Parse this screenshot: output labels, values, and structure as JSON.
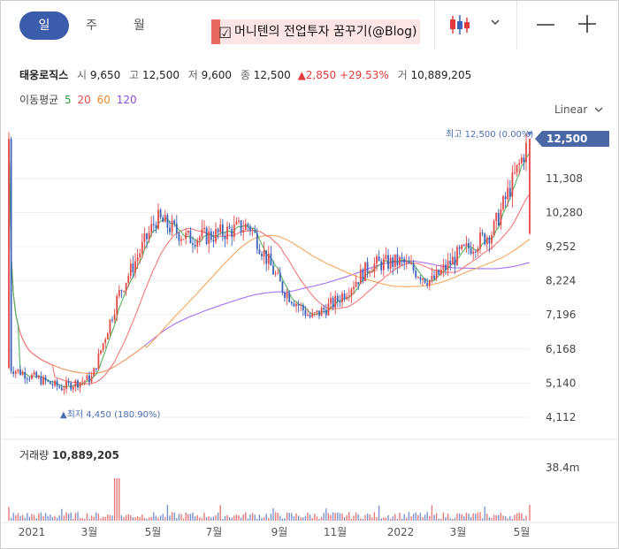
{
  "tabs": {
    "day": "일",
    "week": "주",
    "month": "월"
  },
  "watermark": "머니텐의 전업투자 꿈꾸기(@Blog)",
  "stock": {
    "name": "태웅로직스",
    "open_label": "시",
    "open": "9,650",
    "high_label": "고",
    "high": "12,500",
    "low_label": "저",
    "low": "9,600",
    "close_label": "종",
    "close": "12,500",
    "change": "▲2,850",
    "change_pct": "+29.53%",
    "volume_label": "거",
    "volume": "10,889,205"
  },
  "ma": {
    "label": "이동평균",
    "p5": "5",
    "p20": "20",
    "p60": "60",
    "p120": "120"
  },
  "scale_label": "Linear",
  "chart_data": {
    "type": "candlestick",
    "ticker_name": "태웅로직스",
    "y_ticks": [
      "12,500",
      "11,308",
      "10,280",
      "9,252",
      "8,224",
      "7,196",
      "6,168",
      "5,140",
      "4,112"
    ],
    "y_tick_values": [
      12500,
      11308,
      10280,
      9252,
      8224,
      7196,
      6168,
      5140,
      4112
    ],
    "x_ticks": [
      "2021",
      "3월",
      "5월",
      "7월",
      "9월",
      "11월",
      "2022",
      "3월",
      "5월"
    ],
    "high_annotation": "최고 12,500 (0.00%)",
    "low_annotation": "▲최저 4,450 (180.90%)",
    "last_price_label": "12,500",
    "price_series_approx": [
      {
        "date": "2021-01",
        "close": 5600
      },
      {
        "date": "2021-02",
        "close": 5000
      },
      {
        "date": "2021-03",
        "close": 5300
      },
      {
        "date": "2021-04",
        "close": 7800
      },
      {
        "date": "2021-05",
        "close": 10100
      },
      {
        "date": "2021-06",
        "close": 9500
      },
      {
        "date": "2021-07",
        "close": 9600
      },
      {
        "date": "2021-08",
        "close": 9900
      },
      {
        "date": "2021-09",
        "close": 8000
      },
      {
        "date": "2021-10",
        "close": 7100
      },
      {
        "date": "2021-11",
        "close": 7600
      },
      {
        "date": "2021-12",
        "close": 8700
      },
      {
        "date": "2022-01",
        "close": 8800
      },
      {
        "date": "2022-02",
        "close": 8200
      },
      {
        "date": "2022-03",
        "close": 9000
      },
      {
        "date": "2022-04",
        "close": 9700
      },
      {
        "date": "2022-05",
        "close": 12500
      }
    ],
    "volume_label": "거래량",
    "volume_value": "10,889,205",
    "volume_axis_tick": "38.4m"
  }
}
